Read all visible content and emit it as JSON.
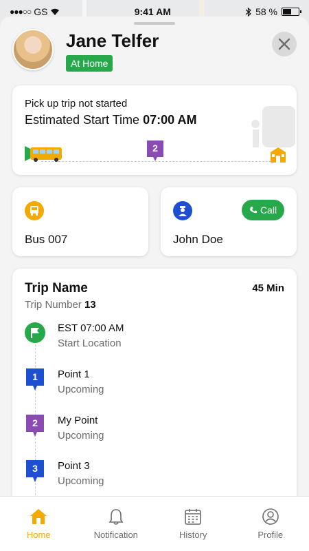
{
  "status_bar": {
    "carrier": "GS",
    "time": "9:41 AM",
    "battery": "58 %",
    "battery_level": 0.58
  },
  "profile": {
    "name": "Jane Telfer",
    "status": "At Home"
  },
  "trip_status": {
    "message": "Pick up trip not started",
    "eta_label": "Estimated Start Time",
    "eta_time": "07:00 AM",
    "stop_number": "2"
  },
  "bus": {
    "label": "Bus 007"
  },
  "driver": {
    "name": "John Doe",
    "call_label": "Call"
  },
  "trip": {
    "name": "Trip Name",
    "duration": "45 Min",
    "number_label": "Trip Number",
    "number": "13",
    "stops": [
      {
        "marker": "",
        "title": "EST 07:00 AM",
        "subtitle": "Start Location",
        "color": "#27a84a"
      },
      {
        "marker": "1",
        "title": "Point 1",
        "subtitle": "Upcoming",
        "color": "#1f4fd1"
      },
      {
        "marker": "2",
        "title": "My Point",
        "subtitle": "Upcoming",
        "color": "#8a4bb3"
      },
      {
        "marker": "3",
        "title": "Point 3",
        "subtitle": "Upcoming",
        "color": "#1f4fd1"
      }
    ]
  },
  "nav": {
    "items": [
      {
        "label": "Home",
        "icon": "home-icon",
        "active": true
      },
      {
        "label": "Notification",
        "icon": "bell-icon",
        "active": false
      },
      {
        "label": "History",
        "icon": "calendar-icon",
        "active": false
      },
      {
        "label": "Profile",
        "icon": "profile-icon",
        "active": false
      }
    ]
  },
  "colors": {
    "accent": "#f4a900",
    "green": "#27a84a",
    "blue": "#1f4fd1",
    "purple": "#8a4bb3"
  }
}
